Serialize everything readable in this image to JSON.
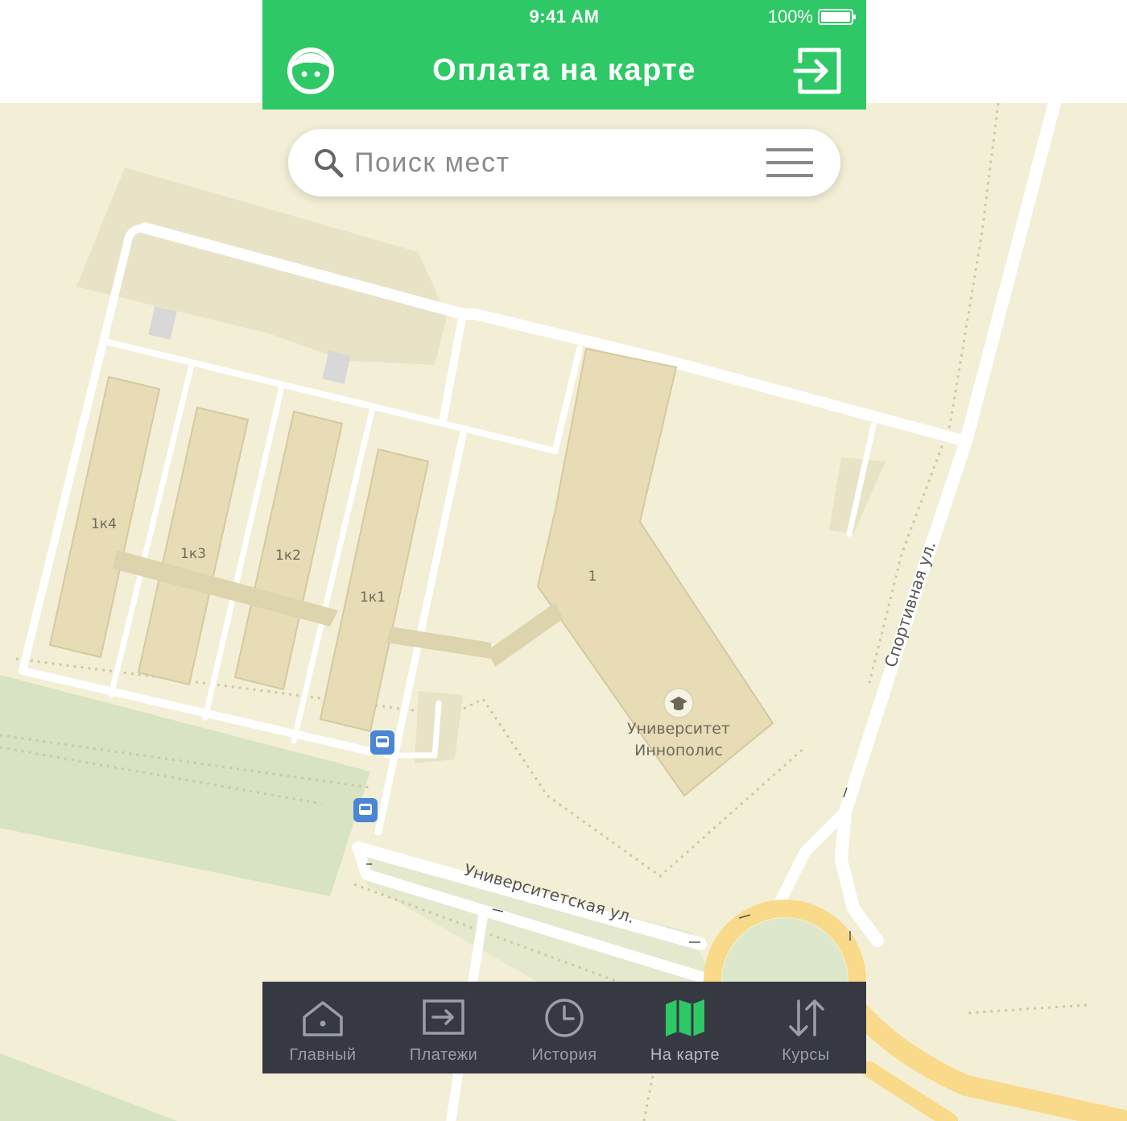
{
  "status_bar": {
    "time": "9:41 AM",
    "battery": "100%"
  },
  "header": {
    "title": "Оплата на карте",
    "profile_icon": "face-icon",
    "logout_icon": "logout-icon"
  },
  "search": {
    "placeholder": "Поиск мест",
    "value": "",
    "menu_icon": "hamburger-menu-icon"
  },
  "map": {
    "buildings": [
      "1к4",
      "1к3",
      "1к2",
      "1к1",
      "1"
    ],
    "poi": {
      "name_line1": "Университет",
      "name_line2": "Иннополис",
      "icon": "graduation-cap-icon"
    },
    "streets": [
      "Спортивная ул.",
      "Университетская ул."
    ],
    "colors": {
      "land": "#f3eed6",
      "green": "#d7e3c3",
      "building": "#e8dfbc",
      "road": "#ffffff",
      "major_road": "#f8da8a",
      "bus_stop": "#4a86d4"
    }
  },
  "tabs": [
    {
      "label": "Главный",
      "icon": "home-icon",
      "active": false
    },
    {
      "label": "Платежи",
      "icon": "payments-icon",
      "active": false
    },
    {
      "label": "История",
      "icon": "clock-icon",
      "active": false
    },
    {
      "label": "На карте",
      "icon": "map-icon",
      "active": true
    },
    {
      "label": "Курсы",
      "icon": "exchange-arrows-icon",
      "active": false
    }
  ],
  "colors": {
    "accent": "#2ec866",
    "tab_bar": "#363941",
    "tab_inactive": "#9b9ea6"
  }
}
